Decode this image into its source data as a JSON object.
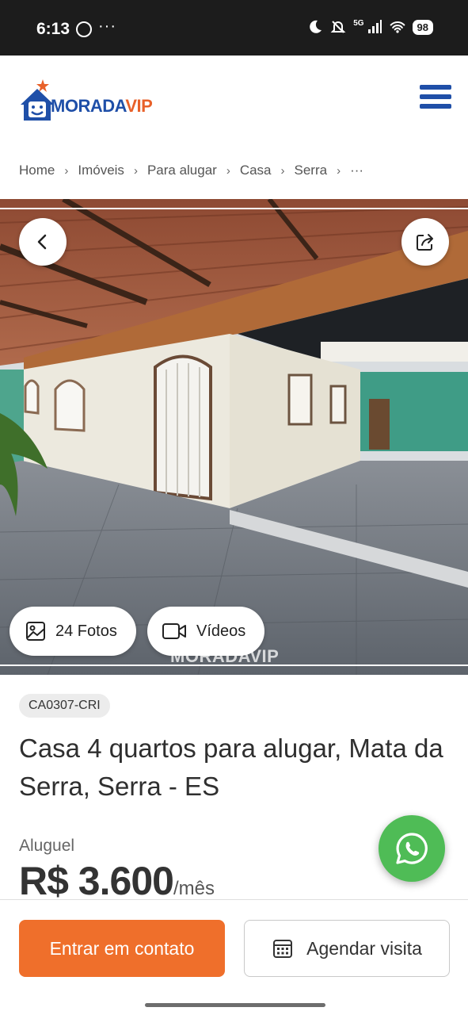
{
  "status_bar": {
    "time": "6:13",
    "dots": "···",
    "network": "5G",
    "battery": "98"
  },
  "header": {
    "logo_part1": "MORADA",
    "logo_part2": "VIP",
    "brand_color": "#1f4fa8",
    "accent_color": "#e8612a"
  },
  "breadcrumb": {
    "items": [
      "Home",
      "Imóveis",
      "Para alugar",
      "Casa",
      "Serra",
      "···"
    ]
  },
  "gallery": {
    "photos_label": "24 Fotos",
    "videos_label": "Vídeos",
    "watermark": "MORADAVIP"
  },
  "listing": {
    "code": "CA0307-CRI",
    "title": "Casa 4 quartos para alugar, Mata da Serra, Serra - ES",
    "price_label": "Aluguel",
    "price": "R$ 3.600",
    "price_unit": "/mês"
  },
  "actions": {
    "contact_label": "Entrar em contato",
    "visit_label": "Agendar visita",
    "contact_color": "#ef6f2b",
    "whatsapp_color": "#4fbc56"
  }
}
